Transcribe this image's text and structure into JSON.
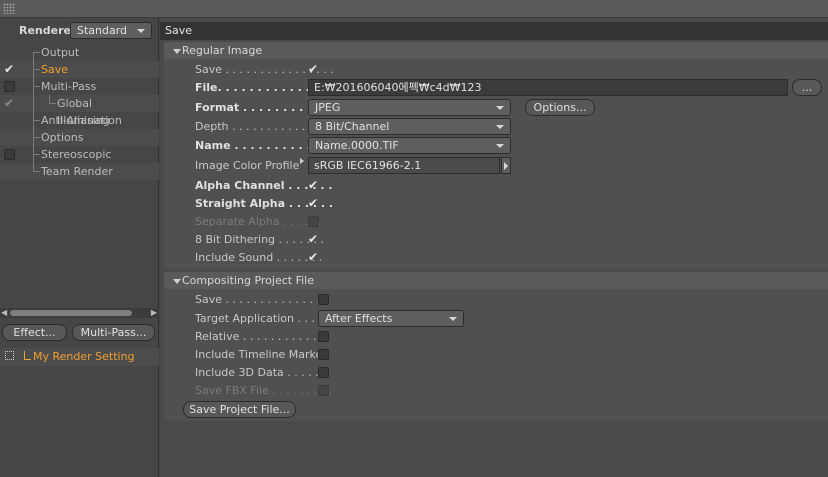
{
  "left": {
    "renderer_label": "Renderer",
    "renderer_value": "Standard",
    "tree": [
      {
        "label": "Output",
        "check": "none",
        "active": false
      },
      {
        "label": "Save",
        "check": "checked",
        "active": true
      },
      {
        "label": "Multi-Pass",
        "check": "box",
        "active": false
      },
      {
        "label": "Global Illumination",
        "check": "checked-dim",
        "active": false
      },
      {
        "label": "Anti-Aliasing",
        "check": "none",
        "active": false
      },
      {
        "label": "Options",
        "check": "none",
        "active": false
      },
      {
        "label": "Stereoscopic",
        "check": "box",
        "active": false
      },
      {
        "label": "Team Render",
        "check": "none",
        "active": false
      }
    ],
    "effect_button": "Effect...",
    "multipass_button": "Multi-Pass...",
    "render_setting": "My Render Setting"
  },
  "right": {
    "header": "Save",
    "regular_image": {
      "title": "Regular Image",
      "save_label": "Save . . . . . . . . . . . . . . . .",
      "file_label": "File. . . . . . . . . . . . . . . .",
      "file_value": "E:₩201606040에펙₩c4d₩123",
      "file_button": "...",
      "format_label": "Format . . . . . . . . . . . .",
      "format_value": "JPEG",
      "options_button": "Options...",
      "depth_label": "Depth . . . . . . . . . . . . . .",
      "depth_value": "8 Bit/Channel",
      "name_label": "Name . . . . . . . . . . . . . .",
      "name_value": "Name.0000.TIF",
      "profile_label": "Image Color Profile",
      "profile_value": "sRGB IEC61966-2.1",
      "alpha_label": "Alpha Channel . . . . . .",
      "straight_label": "Straight Alpha . . . . . .",
      "separate_label": "Separate Alpha . . . . . .",
      "dither_label": "8 Bit Dithering . . . . . . .",
      "sound_label": "Include Sound . . . . . . ."
    },
    "compositing": {
      "title": "Compositing Project File",
      "save_label": "Save . . . . . . . . . . . . . . .",
      "target_label": "Target Application . . . .",
      "target_value": "After Effects",
      "relative_label": "Relative . . . . . . . . . . . .",
      "timeline_label": "Include Timeline Marker",
      "data3d_label": "Include 3D Data . . . . . .",
      "fbx_label": "Save FBX File . . . . . . . . .",
      "save_project_button": "Save Project File..."
    }
  }
}
